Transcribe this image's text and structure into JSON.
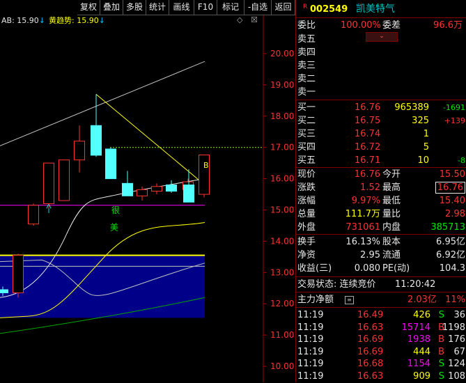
{
  "toolbar": {
    "buttons": [
      "复权",
      "叠加",
      "多股",
      "统计",
      "画线",
      "F10",
      "标记",
      "-自选",
      "返回"
    ]
  },
  "indicators": {
    "ab": "AB: 15.90",
    "ab_arrow": "↓",
    "huang_label": "黄趋势: ",
    "huang_value": "15.90",
    "huang_arrow": "↓",
    "corner_icons": [
      "◇",
      "☒"
    ]
  },
  "chart_data": {
    "type": "candlestick",
    "y_ticks": [
      "20.00",
      "19.00",
      "18.00",
      "17.00",
      "16.00",
      "15.00",
      "14.00",
      "13.00",
      "12.00",
      "11.00",
      "10.00"
    ],
    "ylim": [
      10.0,
      20.0
    ],
    "candles": [
      {
        "open": 12.45,
        "close": 12.35,
        "high": 12.55,
        "low": 12.25
      },
      {
        "open": 12.35,
        "close": 13.55,
        "high": 13.6,
        "low": 12.2
      },
      {
        "open": 14.55,
        "close": 15.15,
        "high": 15.2,
        "low": 14.5
      },
      {
        "open": 15.2,
        "close": 16.5,
        "high": 16.5,
        "low": 15.05
      },
      {
        "open": 15.3,
        "close": 16.6,
        "high": 16.6,
        "low": 15.3
      },
      {
        "open": 16.6,
        "close": 17.2,
        "high": 17.7,
        "low": 16.2
      },
      {
        "open": 17.7,
        "close": 16.75,
        "high": 18.7,
        "low": 16.7
      },
      {
        "open": 16.95,
        "close": 16.0,
        "high": 17.0,
        "low": 16.0
      },
      {
        "open": 15.85,
        "close": 15.45,
        "high": 16.25,
        "low": 15.45
      },
      {
        "open": 15.45,
        "close": 15.65,
        "high": 15.75,
        "low": 15.3
      },
      {
        "open": 15.6,
        "close": 15.75,
        "high": 15.85,
        "low": 15.5
      },
      {
        "open": 15.8,
        "close": 15.6,
        "high": 15.95,
        "low": 15.55
      },
      {
        "open": 15.65,
        "close": 15.9,
        "high": 16.0,
        "low": 15.5
      },
      {
        "open": 15.8,
        "close": 15.25,
        "high": 16.3,
        "low": 15.25
      },
      {
        "open": 15.5,
        "close": 16.76,
        "high": 16.76,
        "low": 15.4
      }
    ],
    "candle_labels": [
      "B"
    ],
    "labels_vertical": [
      "很",
      "美"
    ],
    "dashed_level": 17.0,
    "magenta_level": 15.15,
    "yellow_level": 13.55
  },
  "quote": {
    "badge": "R",
    "code": "002549",
    "name": "凯美特气",
    "weibi_label": "委比",
    "weibi_value": "100.00%",
    "weicha_label": "委差",
    "weicha_value": "96.6万",
    "sell": [
      {
        "label": "卖五"
      },
      {
        "label": "卖四"
      },
      {
        "label": "卖三"
      },
      {
        "label": "卖二"
      },
      {
        "label": "卖一"
      }
    ],
    "buy": [
      {
        "label": "买一",
        "price": "16.76",
        "vol": "965389",
        "chg": "-1691"
      },
      {
        "label": "买二",
        "price": "16.75",
        "vol": "325",
        "chg": "+139"
      },
      {
        "label": "买三",
        "price": "16.74",
        "vol": "1",
        "chg": ""
      },
      {
        "label": "买四",
        "price": "16.72",
        "vol": "5",
        "chg": ""
      },
      {
        "label": "买五",
        "price": "16.71",
        "vol": "10",
        "chg": "-8"
      }
    ],
    "stats": [
      {
        "l1": "现价",
        "v1": "16.76",
        "l2": "今开",
        "v2": "15.50"
      },
      {
        "l1": "涨跌",
        "v1": "1.52",
        "l2": "最高",
        "v2": "16.76"
      },
      {
        "l1": "涨幅",
        "v1": "9.97%",
        "l2": "最低",
        "v2": "15.40"
      },
      {
        "l1": "总量",
        "v1": "111.7万",
        "l2": "量比",
        "v2": "2.98"
      },
      {
        "l1": "外盘",
        "v1": "731061",
        "l2": "内盘",
        "v2": "385713"
      }
    ],
    "stats2": [
      {
        "l1": "换手",
        "v1": "16.13%",
        "l2": "股本",
        "v2": "6.95亿"
      },
      {
        "l1": "净资",
        "v1": "2.95",
        "l2": "流通",
        "v2": "6.92亿"
      },
      {
        "l1": "收益(三)",
        "v1": "0.080",
        "l2": "PE(动)",
        "v2": "104.3"
      }
    ],
    "trade_status_label": "交易状态: 连续竞价",
    "trade_time": "11:20:42",
    "main_flow_label": "主力净额",
    "main_flow_value": "2.03亿",
    "main_flow_pct": "11%",
    "ticks": [
      {
        "time": "11:19",
        "price": "16.49",
        "vol": "426",
        "side": "S",
        "n": "36"
      },
      {
        "time": "11:19",
        "price": "16.63",
        "vol": "15714",
        "side": "B",
        "n": "1198"
      },
      {
        "time": "11:19",
        "price": "16.69",
        "vol": "1938",
        "side": "B",
        "n": "176"
      },
      {
        "time": "11:19",
        "price": "16.69",
        "vol": "444",
        "side": "B",
        "n": "67"
      },
      {
        "time": "11:19",
        "price": "16.68",
        "vol": "1154",
        "side": "S",
        "n": "124"
      },
      {
        "time": "11:19",
        "price": "16.63",
        "vol": "909",
        "side": "S",
        "n": "108"
      }
    ]
  }
}
